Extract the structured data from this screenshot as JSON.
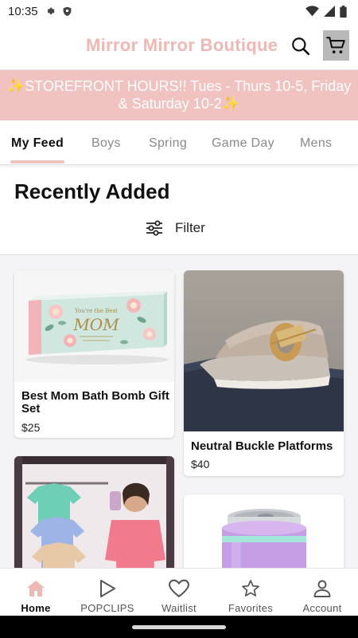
{
  "status_bar": {
    "time": "10:35"
  },
  "header": {
    "brand": "Mirror Mirror Boutique"
  },
  "announcement": {
    "text": "✨STOREFRONT HOURS!! Tues - Thurs 10-5, Friday & Saturday 10-2✨"
  },
  "tabs": [
    {
      "label": "My Feed",
      "active": true
    },
    {
      "label": "Boys"
    },
    {
      "label": "Spring"
    },
    {
      "label": "Game Day"
    },
    {
      "label": "Mens"
    }
  ],
  "section": {
    "title": "Recently Added",
    "filter_label": "Filter"
  },
  "products": [
    {
      "name": "Best Mom Bath Bomb Gift Set",
      "price": "$25",
      "image": "bath-bomb-gift-box"
    },
    {
      "name": "Neutral Buckle Platforms",
      "price": "$40",
      "image": "buckle-platform-sandal"
    },
    {
      "name": "",
      "price": "",
      "image": "tees-mirror-selfie"
    },
    {
      "name": "",
      "price": "",
      "image": "purple-can-cooler"
    }
  ],
  "gift_box_text": {
    "line1": "You're the Best",
    "line2": "MOM"
  },
  "bottom_nav": [
    {
      "label": "Home",
      "icon": "home-icon",
      "active": true
    },
    {
      "label": "POPCLIPS",
      "icon": "play-icon"
    },
    {
      "label": "Waitlist",
      "icon": "heart-icon"
    },
    {
      "label": "Favorites",
      "icon": "star-icon"
    },
    {
      "label": "Account",
      "icon": "person-icon"
    }
  ],
  "colors": {
    "brand_pink": "#f0b8b4",
    "banner_pink": "#f0c2c0",
    "active_nav": "#f0b8b4"
  }
}
